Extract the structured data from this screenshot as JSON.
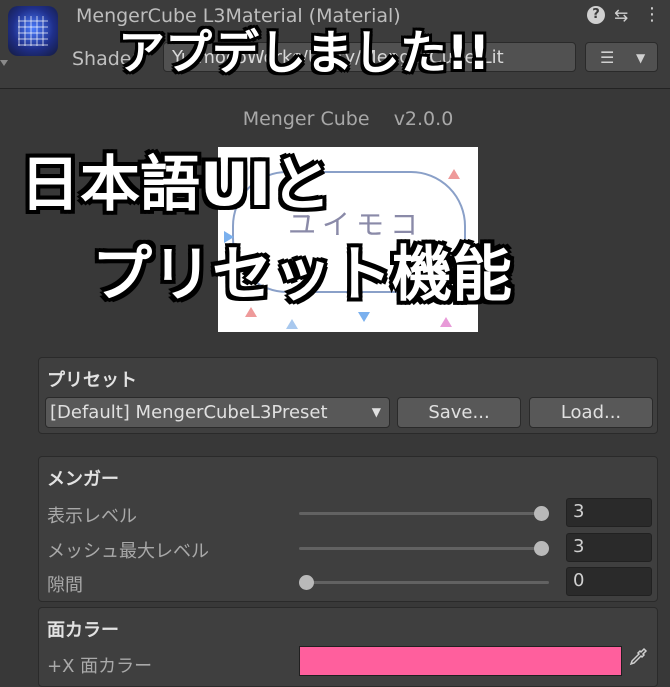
{
  "header": {
    "material_title": "MengerCube L3Material (Material)",
    "shader_label": "Shader",
    "shader_value": "YuimocoWorks/Unity/MengerCube/Lit",
    "icons": [
      "material-icon",
      "help-icon",
      "settings-icon",
      "more-icon",
      "list-icon"
    ],
    "help_glyph": "?",
    "settings_glyph": "⇆",
    "more_glyph": "⋮",
    "list_glyph": "☰",
    "dropdown_arrow": "▼"
  },
  "overlay": {
    "title": "アプデしました!!",
    "line1": "日本語UIと",
    "line2": "プリセット機能"
  },
  "product": {
    "name": "Menger Cube",
    "version": "v2.0.0",
    "logo_text": "ユイモコ"
  },
  "preset": {
    "title": "プリセット",
    "selected": "[Default] MengerCubeL3Preset",
    "save_label": "Save...",
    "load_label": "Load..."
  },
  "menger": {
    "title": "メンガー",
    "rows": [
      {
        "label": "表示レベル",
        "value": "3",
        "fraction": 1.0
      },
      {
        "label": "メッシュ最大レベル",
        "value": "3",
        "fraction": 1.0
      },
      {
        "label": "隙間",
        "value": "0",
        "fraction": 0.0
      }
    ]
  },
  "face_color": {
    "title": "面カラー",
    "row_label": "+X 面カラー",
    "color": "#ff5f9d",
    "picker_icon": "eyedropper-icon"
  },
  "colors": {
    "background": "#383838",
    "accent_pink": "#ff5f9d"
  }
}
